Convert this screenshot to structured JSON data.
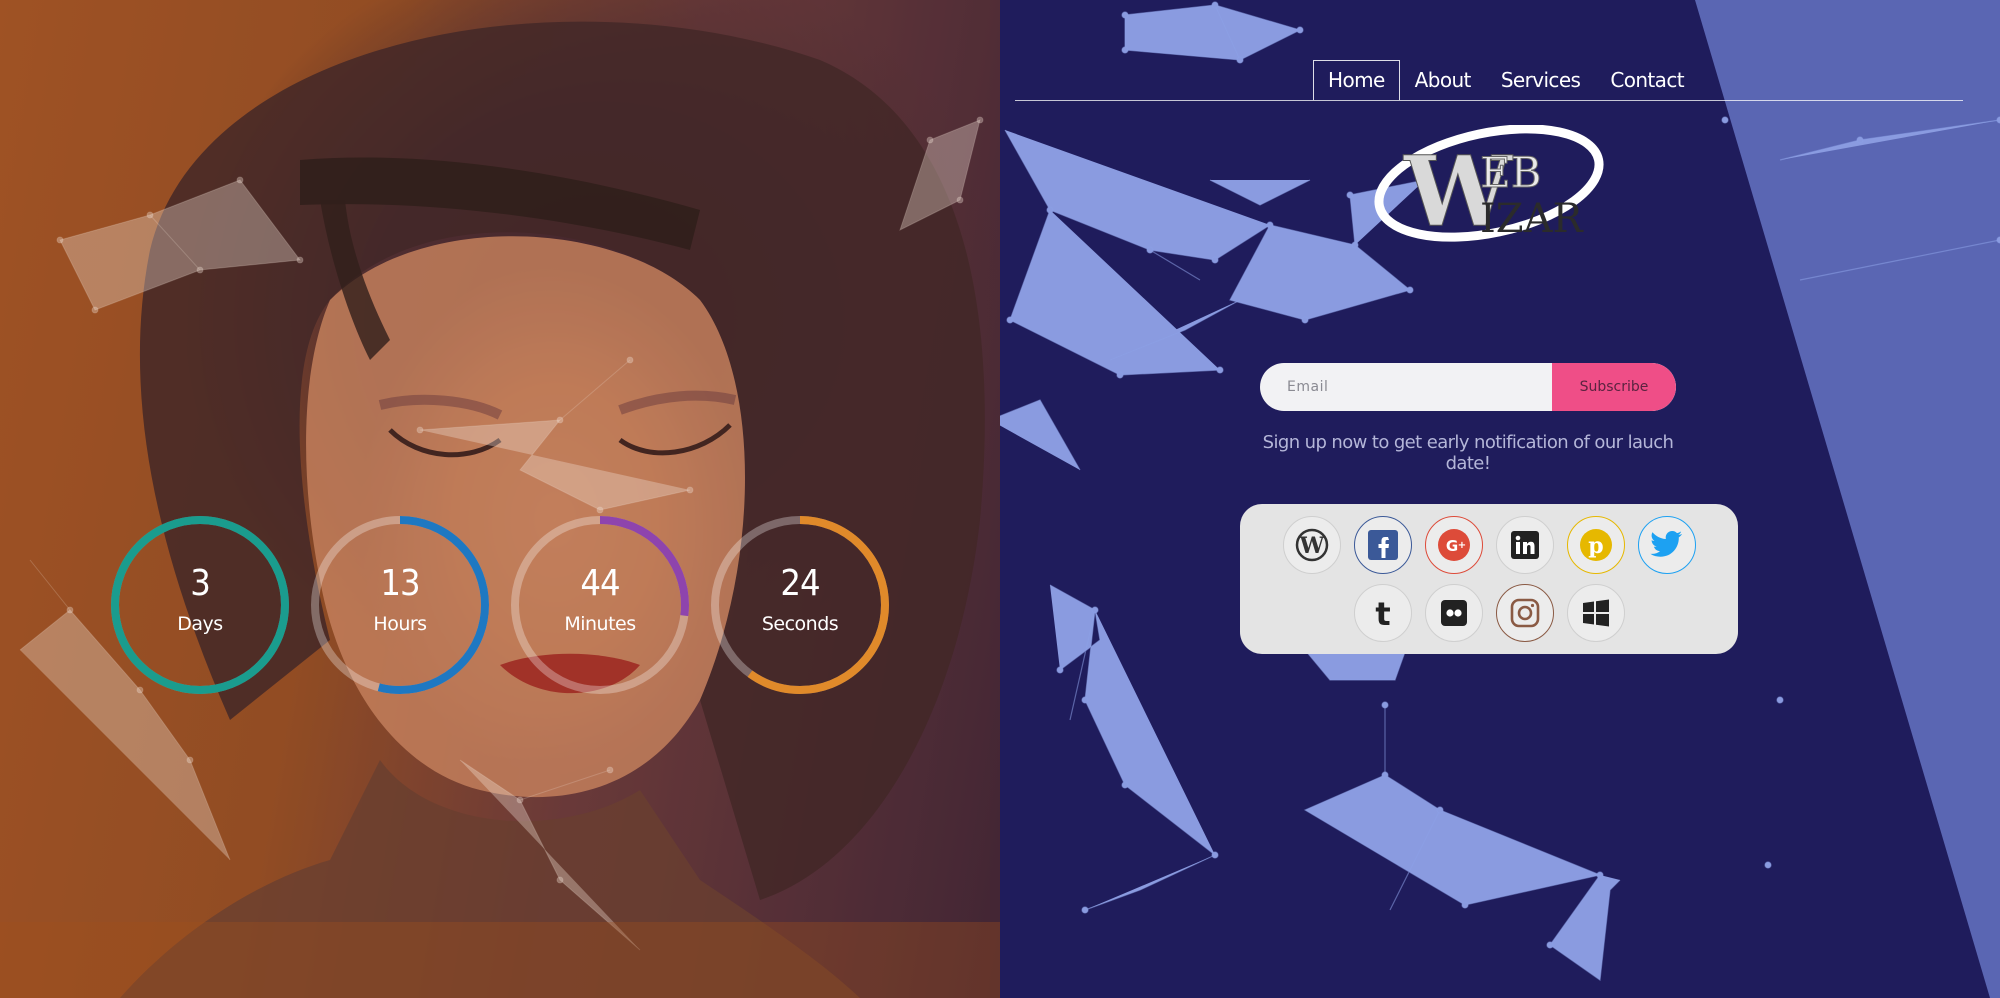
{
  "nav": {
    "items": [
      {
        "label": "Home",
        "active": true
      },
      {
        "label": "About",
        "active": false
      },
      {
        "label": "Services",
        "active": false
      },
      {
        "label": "Contact",
        "active": false
      }
    ]
  },
  "logo": {
    "text_top": "EB",
    "text_bottom": "IZAR",
    "initial": "W",
    "name": "Web Wizar logo"
  },
  "countdown": [
    {
      "value": "3",
      "label": "Days",
      "progress": 1.0,
      "color": "#1a9c8e"
    },
    {
      "value": "13",
      "label": "Hours",
      "progress": 0.54,
      "color": "#1e78c2"
    },
    {
      "value": "44",
      "label": "Minutes",
      "progress": 0.27,
      "color": "#8e44ad"
    },
    {
      "value": "24",
      "label": "Seconds",
      "progress": 0.6,
      "color": "#e08a2a"
    }
  ],
  "subscribe": {
    "email_placeholder": "Email",
    "button_label": "Subscribe",
    "note": "Sign up now to get early notification of our lauch date!"
  },
  "social": [
    {
      "icon": "wordpress-icon",
      "color": "#333333"
    },
    {
      "icon": "facebook-icon",
      "color": "#3b5998"
    },
    {
      "icon": "google-plus-icon",
      "color": "#dd4b39"
    },
    {
      "icon": "linkedin-icon",
      "color": "#222222"
    },
    {
      "icon": "pinterest-icon",
      "color": "#e6b800"
    },
    {
      "icon": "twitter-icon",
      "color": "#1da1f2"
    },
    {
      "icon": "tumblr-icon",
      "color": "#222222"
    },
    {
      "icon": "flickr-icon",
      "color": "#222222"
    },
    {
      "icon": "instagram-icon",
      "color": "#8a5a44"
    },
    {
      "icon": "windows-icon",
      "color": "#222222"
    }
  ],
  "colors": {
    "background": "#1f1c5c",
    "accent": "#ef4e87",
    "wedge": "#5a66b3"
  }
}
